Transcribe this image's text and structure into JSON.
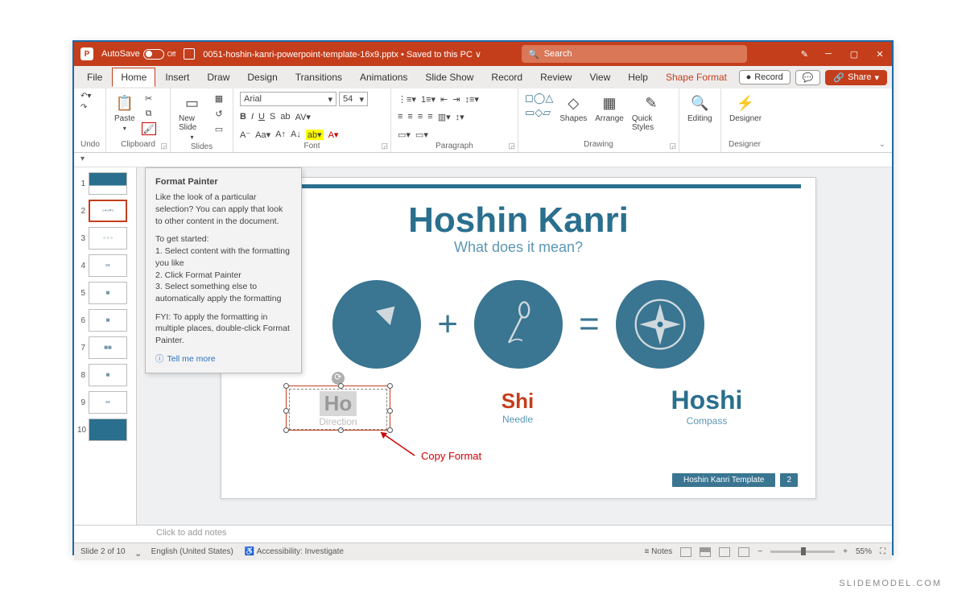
{
  "titlebar": {
    "autosave_label": "AutoSave",
    "autosave_state": "Off",
    "filename": "0051-hoshin-kanri-powerpoint-template-16x9.pptx",
    "saved_status": "Saved to this PC",
    "search_placeholder": "Search"
  },
  "tabs": {
    "file": "File",
    "home": "Home",
    "insert": "Insert",
    "draw": "Draw",
    "design": "Design",
    "transitions": "Transitions",
    "animations": "Animations",
    "slideshow": "Slide Show",
    "record": "Record",
    "review": "Review",
    "view": "View",
    "help": "Help",
    "shapeformat": "Shape Format",
    "record_btn": "Record",
    "share_btn": "Share"
  },
  "ribbon": {
    "undo": "Undo",
    "clipboard": "Clipboard",
    "paste": "Paste",
    "slides": "Slides",
    "newslide": "New Slide",
    "font": "Font",
    "fontname": "Arial",
    "fontsize": "54",
    "paragraph": "Paragraph",
    "drawing": "Drawing",
    "shapes": "Shapes",
    "arrange": "Arrange",
    "quickstyles": "Quick Styles",
    "editing": "Editing",
    "designer": "Designer"
  },
  "tooltip": {
    "title": "Format Painter",
    "p1": "Like the look of a particular selection? You can apply that look to other content in the document.",
    "p2": "To get started:",
    "s1": "1. Select content with the formatting you like",
    "s2": "2. Click Format Painter",
    "s3": "3. Select something else to automatically apply the formatting",
    "p3": "FYI: To apply the formatting in multiple places, double-click Format Painter.",
    "tellmore": "Tell me more"
  },
  "slide": {
    "title": "Hoshin Kanri",
    "subtitle": "What does it mean?",
    "ho": "Ho",
    "ho_sub": "Direction",
    "shi": "Shi",
    "shi_sub": "Needle",
    "hoshi": "Hoshi",
    "hoshi_sub": "Compass",
    "footer_text": "Hoshin Kanri Template",
    "footer_num": "2"
  },
  "annotation": {
    "copy": "Copy Format"
  },
  "thumbs": [
    "1",
    "2",
    "3",
    "4",
    "5",
    "6",
    "7",
    "8",
    "9",
    "10"
  ],
  "notes": {
    "placeholder": "Click to add notes"
  },
  "status": {
    "slide": "Slide 2 of 10",
    "lang": "English (United States)",
    "access": "Accessibility: Investigate",
    "notes": "Notes",
    "zoom": "55%"
  },
  "watermark": "SLIDEMODEL.COM"
}
